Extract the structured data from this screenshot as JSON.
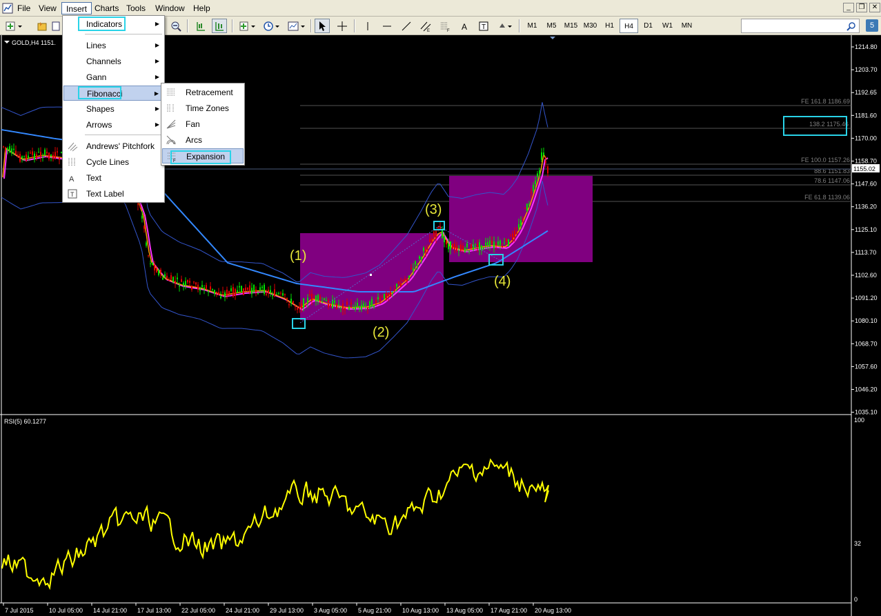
{
  "menubar": {
    "items": [
      "File",
      "View",
      "Insert",
      "Charts",
      "Tools",
      "Window",
      "Help"
    ]
  },
  "toolbar": {
    "timeframes": [
      "M1",
      "M5",
      "M15",
      "M30",
      "H1",
      "H4",
      "D1",
      "W1",
      "MN"
    ],
    "active_timeframe": "H4",
    "notify_count": "5"
  },
  "chart": {
    "symbol_label": "GOLD,H4  1151.",
    "current_price": "1155.02",
    "price_axis": [
      "1214.80",
      "1203.70",
      "1192.65",
      "1181.60",
      "1170.00",
      "1158.70",
      "1147.60",
      "1136.20",
      "1125.10",
      "1113.70",
      "1102.60",
      "1091.20",
      "1080.10",
      "1068.70",
      "1057.60",
      "1046.20",
      "1035.10"
    ],
    "fibo_levels": [
      {
        "label": "FE 161.8  1186.69"
      },
      {
        "label": "138.2  1175.46"
      },
      {
        "label": "FE 100.0  1157.26"
      },
      {
        "label": "88.6  1151.83"
      },
      {
        "label": "78.6  1147.06"
      },
      {
        "label": "FE 61.8  1139.06"
      }
    ],
    "wave_labels": [
      "(1)",
      "(2)",
      "(3)",
      "(4)"
    ],
    "rsi_label": "RSI(5) 60.1277",
    "rsi_axis": [
      "100",
      "32",
      "0"
    ],
    "time_axis": [
      "7 Jul 2015",
      "10 Jul 05:00",
      "14 Jul 21:00",
      "17 Jul 13:00",
      "22 Jul 05:00",
      "24 Jul 21:00",
      "29 Jul 13:00",
      "3 Aug 05:00",
      "5 Aug 21:00",
      "10 Aug 13:00",
      "13 Aug 05:00",
      "17 Aug 21:00",
      "20 Aug 13:00"
    ],
    "colors": {
      "background": "#000000",
      "bull": "#00e000",
      "bear": "#e00000",
      "ma_fast": "#ff9900",
      "ma_mid": "#ff33ff",
      "ma_slow": "#3388ff",
      "bands": "#3355cc",
      "rsi": "#ffff00",
      "box": "#800080"
    }
  },
  "insert_menu": {
    "items": [
      "Indicators",
      "Lines",
      "Channels",
      "Gann",
      "Fibonacci",
      "Shapes",
      "Arrows",
      "Andrews' Pitchfork",
      "Cycle Lines",
      "Text",
      "Text Label"
    ]
  },
  "fibonacci_submenu": {
    "items": [
      "Retracement",
      "Time Zones",
      "Fan",
      "Arcs",
      "Expansion"
    ]
  }
}
